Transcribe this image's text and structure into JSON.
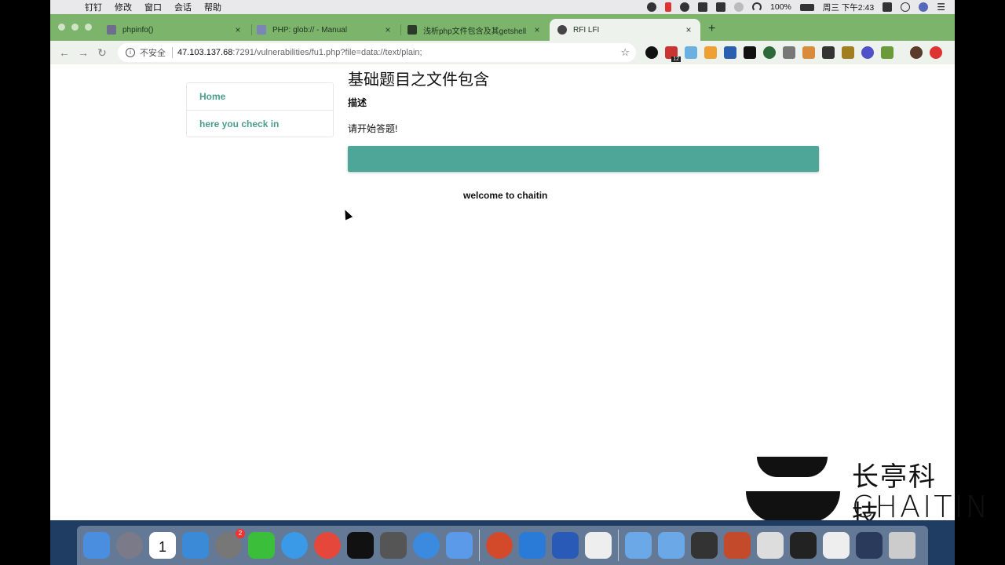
{
  "menubar": {
    "items": [
      "钉钉",
      "修改",
      "窗口",
      "会话",
      "帮助"
    ],
    "battery": "100%",
    "clock": "周三 下午2:43"
  },
  "tabs": [
    {
      "title": "phpinfo()",
      "close": "×"
    },
    {
      "title": "PHP: glob:// - Manual",
      "close": "×"
    },
    {
      "title": "浅析php文件包含及其getshell",
      "close": "×"
    },
    {
      "title": "RFI LFI",
      "close": "×"
    }
  ],
  "new_tab": "+",
  "address": {
    "security_label": "不安全",
    "host": "47.103.137.68",
    "path": ":7291/vulnerabilities/fu1.php?file=data://text/plain;"
  },
  "extensions": {
    "badge": "12"
  },
  "sidebar": {
    "items": [
      {
        "label": "Home"
      },
      {
        "label": "here you check in"
      }
    ]
  },
  "main": {
    "title": "基础题目之文件包含",
    "desc_label": "描述",
    "prompt": "请开始答题!",
    "welcome": "welcome to chaitin"
  },
  "watermark": {
    "cn": "长亭科技",
    "en": "CHAITIN"
  },
  "dock": {
    "settings_badge": "2",
    "calendar_day": "1"
  },
  "colors": {
    "accent": "#4ea698",
    "tabstrip": "#7cb46b",
    "link": "#4a9d8f"
  }
}
